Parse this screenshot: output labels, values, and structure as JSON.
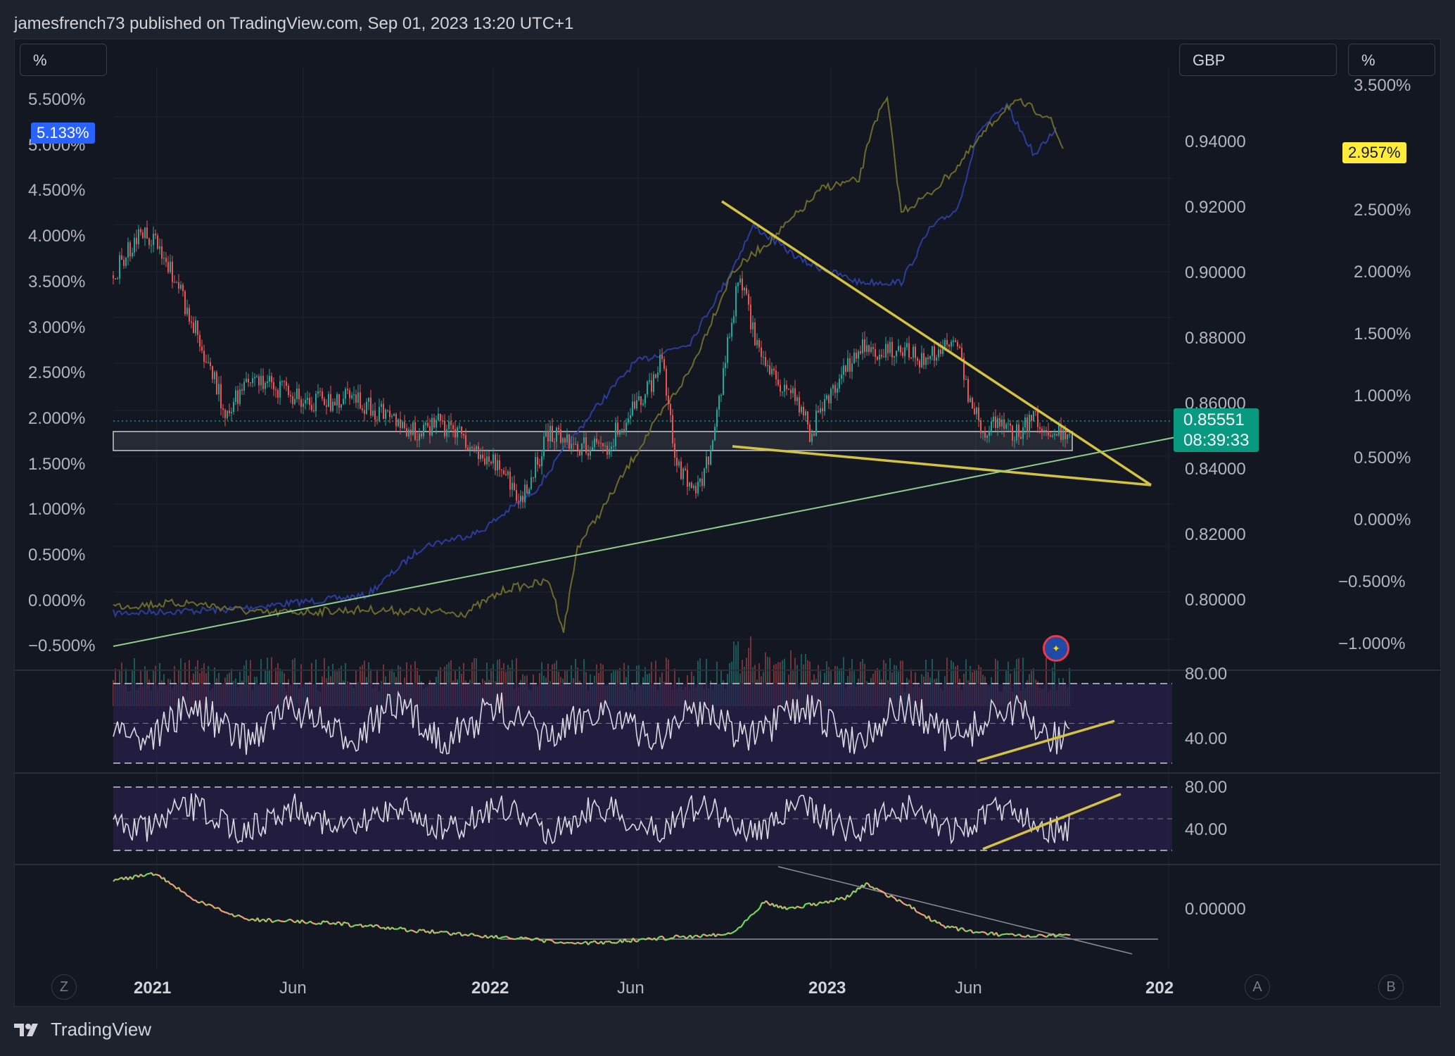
{
  "header": {
    "publisher_line": "jamesfrench73 published on TradingView.com, Sep 01, 2023 13:20 UTC+1"
  },
  "scale_buttons": {
    "left": "%",
    "middle": "GBP",
    "right": "%"
  },
  "left_axis": {
    "ticks": [
      "5.500%",
      "5.000%",
      "4.500%",
      "4.000%",
      "3.500%",
      "3.000%",
      "2.500%",
      "2.000%",
      "1.500%",
      "1.000%",
      "0.500%",
      "0.000%",
      "−0.500%"
    ],
    "current_badge": "5.133%",
    "badge_color": "#2962ff"
  },
  "price_axis": {
    "ticks": [
      "0.94000",
      "0.92000",
      "0.90000",
      "0.88000",
      "0.86000",
      "0.84000",
      "0.82000",
      "0.80000"
    ],
    "current_price": "0.85551",
    "countdown": "08:39:33",
    "badge_color": "#089981"
  },
  "right_axis": {
    "ticks": [
      "3.500%",
      "2.500%",
      "2.000%",
      "1.500%",
      "1.000%",
      "0.500%",
      "0.000%",
      "−0.500%",
      "−1.000%"
    ],
    "current_badge": "2.957%",
    "badge_color": "#ffeb3b"
  },
  "rsi_pane_1": {
    "ticks": [
      "80.00",
      "40.00"
    ]
  },
  "rsi_pane_2": {
    "ticks": [
      "80.00",
      "40.00"
    ]
  },
  "osc_pane": {
    "ticks": [
      "0.00000"
    ]
  },
  "time_axis": {
    "labels": [
      "2021",
      "Jun",
      "2022",
      "Jun",
      "2023",
      "Jun",
      "202"
    ]
  },
  "corner_buttons": {
    "left": "Z",
    "mid": "A",
    "right": "B"
  },
  "footer": {
    "brand": "TradingView"
  },
  "colors": {
    "background": "#131722",
    "candle_up": "#26a69a",
    "candle_down": "#ef5350",
    "trendline_yellow": "#d4c340",
    "trendline_green": "#8fce8a",
    "series_blue": "#2a3d9c",
    "series_olive": "#6e6a2a",
    "rsi_band": "#2a1f4a"
  }
}
